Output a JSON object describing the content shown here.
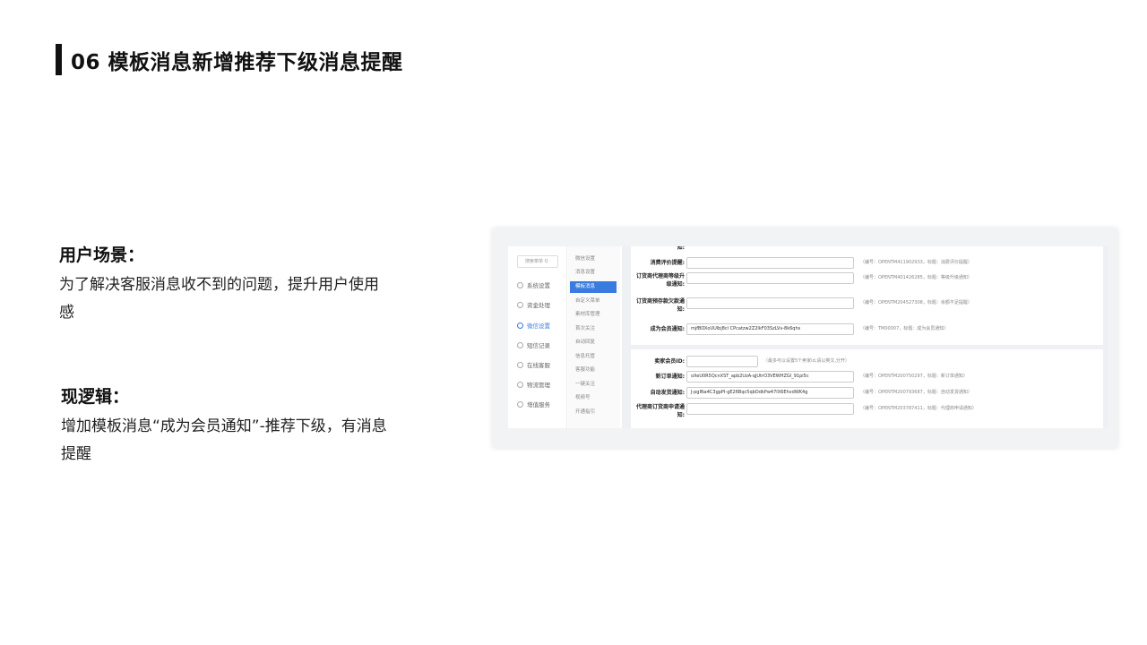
{
  "slide": {
    "title": "06 模板消息新增推荐下级消息提醒"
  },
  "scene": {
    "heading": "用户场景：",
    "body_line1": "为了解决客服消息收不到的问题，提升用户使用",
    "body_line2": "感"
  },
  "logic": {
    "heading": "现逻辑：",
    "body_line1": "增加模板消息“成为会员通知”-推荐下级，有消息",
    "body_line2": "提醒"
  },
  "screenshot": {
    "search_placeholder": "搜索菜单 Q",
    "sidebar": [
      {
        "label": "系统设置",
        "icon": "gear-icon"
      },
      {
        "label": "资金处理",
        "icon": "money-icon"
      },
      {
        "label": "微信设置",
        "icon": "wechat-icon"
      },
      {
        "label": "短信记录",
        "icon": "message-icon"
      },
      {
        "label": "在线客服",
        "icon": "headset-icon"
      },
      {
        "label": "物流管理",
        "icon": "truck-icon"
      },
      {
        "label": "增值服务",
        "icon": "service-icon"
      }
    ],
    "submenu": [
      "微信设置",
      "消息设置",
      "模板消息",
      "自定义菜单",
      "素材库管理",
      "首次关注",
      "自动回复",
      "信息托管",
      "客服功能",
      "一键关注",
      "视频号",
      "开通指引"
    ],
    "card1_rows": [
      {
        "label": "知:",
        "value": "",
        "hint": ""
      },
      {
        "label": "消费评价提醒:",
        "value": "",
        "hint": "（编号：OPENTM411902933，标题：消费评价提醒）"
      },
      {
        "label": "订货商代理商等级升级通知:",
        "value": "",
        "hint": "（编号：OPENTM401426285，标题：等级升级通知）"
      },
      {
        "label": "订货商预存款欠款通知:",
        "value": "",
        "hint": "（编号：OPENTM204527308，标题：余额不足提醒）"
      },
      {
        "label": "成为会员通知:",
        "value": "mjfBOXoUUlbj8cl CPcatzw2Z2lkF03SzLVv-8k6qhs",
        "hint": "（编号：TM00007，标题：成为会员通知）"
      }
    ],
    "card2_rows": [
      {
        "label": "卖家会员ID:",
        "value": "",
        "hint": "（最多可以设置5个卖家id,请以英文,分开）"
      },
      {
        "label": "新订单通知:",
        "value": "oXeU0R5QcnXST_apb2UzA-qjUtrO3VEWHZGI_91pi5c",
        "hint": "（编号：OPENTM200750297，标题：新订单通知）"
      },
      {
        "label": "自动发货通知:",
        "value": "J-pgINa4C3gpPI-gE26Bqc5qbOdkPw47IX6EhvdWK4g",
        "hint": "（编号：OPENTM200793687，标题：自动发货通知）"
      },
      {
        "label": "代理商订货商申请通知:",
        "value": "",
        "hint": "（编号：OPENTM203787411，标题：代理商申请通知）"
      }
    ]
  }
}
